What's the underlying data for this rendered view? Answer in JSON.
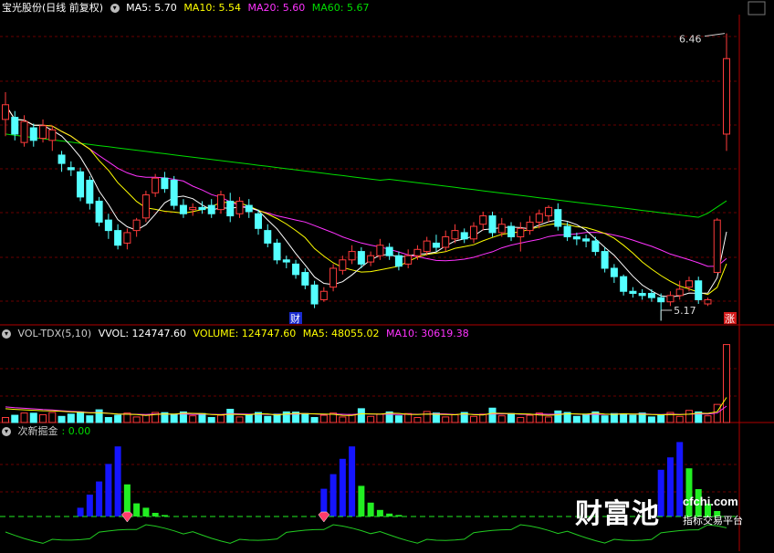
{
  "colors": {
    "up": "#ff3b3b",
    "down": "#54ffff",
    "ma5": "#ffffff",
    "ma10": "#ffff00",
    "ma20": "#ff33ff",
    "ma60": "#00dd00",
    "divider": "#b00000",
    "grid": "#6a0000",
    "bar_blue": "#1515ff",
    "bar_green": "#22ee22"
  },
  "price_panel": {
    "title": "宝光股份(日线 前复权)",
    "ma5_label": "MA5: 5.70",
    "ma10_label": "MA10: 5.54",
    "ma20_label": "MA20: 5.60",
    "ma60_label": "MA60: 5.67",
    "high_marker": "6.46",
    "low_marker": "5.17",
    "finance_badge": "财",
    "limit_up_badge": "涨"
  },
  "volume_panel": {
    "title": "VOL-TDX(5,10)",
    "vvol_label": "VVOL: 124747.60",
    "volume_label": "VOLUME: 124747.60",
    "ma5_label": "MA5: 48055.02",
    "ma10_label": "MA10: 30619.38"
  },
  "indicator_panel": {
    "title": "次新掘金",
    "value_label": ": 0.00"
  },
  "watermark": {
    "brand": "财富池",
    "url": "cfchi.com",
    "slogan": "指标交易平台"
  },
  "chart_data": [
    {
      "type": "candlestick",
      "title": "宝光股份(日线 前复权)",
      "series": [
        {
          "name": "MA5",
          "value": 5.7
        },
        {
          "name": "MA10",
          "value": 5.54
        },
        {
          "name": "MA20",
          "value": 5.6
        },
        {
          "name": "MA60",
          "value": 5.67
        }
      ],
      "high_label": 6.46,
      "low_label": 5.17,
      "ylim": [
        5.07,
        6.55
      ],
      "candles": [
        [
          6.05,
          6.12,
          6.18,
          5.97
        ],
        [
          6.06,
          5.98,
          6.09,
          5.95
        ],
        [
          5.94,
          6.04,
          6.07,
          5.92
        ],
        [
          6.01,
          5.95,
          6.03,
          5.92
        ],
        [
          5.96,
          6.02,
          6.05,
          5.94
        ],
        [
          5.95,
          6.0,
          6.02,
          5.9
        ],
        [
          5.88,
          5.84,
          5.9,
          5.8
        ],
        [
          5.82,
          5.81,
          5.85,
          5.78
        ],
        [
          5.8,
          5.68,
          5.82,
          5.66
        ],
        [
          5.76,
          5.65,
          5.78,
          5.62
        ],
        [
          5.66,
          5.56,
          5.68,
          5.54
        ],
        [
          5.57,
          5.52,
          5.6,
          5.48
        ],
        [
          5.52,
          5.45,
          5.55,
          5.43
        ],
        [
          5.46,
          5.51,
          5.53,
          5.43
        ],
        [
          5.52,
          5.57,
          5.58,
          5.49
        ],
        [
          5.58,
          5.69,
          5.71,
          5.56
        ],
        [
          5.7,
          5.77,
          5.79,
          5.68
        ],
        [
          5.77,
          5.72,
          5.8,
          5.7
        ],
        [
          5.76,
          5.64,
          5.78,
          5.62
        ],
        [
          5.64,
          5.6,
          5.67,
          5.58
        ],
        [
          5.62,
          5.63,
          5.65,
          5.59
        ],
        [
          5.63,
          5.62,
          5.66,
          5.6
        ],
        [
          5.64,
          5.6,
          5.67,
          5.58
        ],
        [
          5.62,
          5.69,
          5.71,
          5.6
        ],
        [
          5.66,
          5.59,
          5.7,
          5.56
        ],
        [
          5.6,
          5.66,
          5.68,
          5.58
        ],
        [
          5.64,
          5.61,
          5.67,
          5.58
        ],
        [
          5.6,
          5.53,
          5.62,
          5.5
        ],
        [
          5.52,
          5.46,
          5.55,
          5.44
        ],
        [
          5.46,
          5.38,
          5.48,
          5.36
        ],
        [
          5.38,
          5.37,
          5.4,
          5.34
        ],
        [
          5.36,
          5.31,
          5.38,
          5.29
        ],
        [
          5.32,
          5.26,
          5.34,
          5.24
        ],
        [
          5.26,
          5.17,
          5.28,
          5.15
        ],
        [
          5.19,
          5.23,
          5.25,
          5.18
        ],
        [
          5.25,
          5.34,
          5.36,
          5.23
        ],
        [
          5.33,
          5.38,
          5.4,
          5.31
        ],
        [
          5.38,
          5.42,
          5.45,
          5.36
        ],
        [
          5.42,
          5.36,
          5.44,
          5.34
        ],
        [
          5.37,
          5.4,
          5.42,
          5.35
        ],
        [
          5.4,
          5.45,
          5.48,
          5.38
        ],
        [
          5.44,
          5.4,
          5.46,
          5.38
        ],
        [
          5.4,
          5.35,
          5.42,
          5.33
        ],
        [
          5.36,
          5.4,
          5.43,
          5.34
        ],
        [
          5.4,
          5.43,
          5.45,
          5.38
        ],
        [
          5.42,
          5.47,
          5.49,
          5.4
        ],
        [
          5.46,
          5.44,
          5.5,
          5.42
        ],
        [
          5.44,
          5.49,
          5.52,
          5.42
        ],
        [
          5.48,
          5.52,
          5.55,
          5.46
        ],
        [
          5.51,
          5.48,
          5.53,
          5.46
        ],
        [
          5.48,
          5.54,
          5.56,
          5.46
        ],
        [
          5.55,
          5.59,
          5.61,
          5.52
        ],
        [
          5.59,
          5.51,
          5.61,
          5.49
        ],
        [
          5.51,
          5.55,
          5.58,
          5.49
        ],
        [
          5.54,
          5.49,
          5.56,
          5.47
        ],
        [
          5.49,
          5.53,
          5.56,
          5.42
        ],
        [
          5.52,
          5.56,
          5.59,
          5.5
        ],
        [
          5.56,
          5.6,
          5.62,
          5.53
        ],
        [
          5.59,
          5.63,
          5.64,
          5.56
        ],
        [
          5.62,
          5.54,
          5.65,
          5.52
        ],
        [
          5.54,
          5.49,
          5.56,
          5.47
        ],
        [
          5.49,
          5.48,
          5.51,
          5.45
        ],
        [
          5.48,
          5.47,
          5.5,
          5.44
        ],
        [
          5.47,
          5.42,
          5.49,
          5.4
        ],
        [
          5.42,
          5.34,
          5.44,
          5.32
        ],
        [
          5.34,
          5.3,
          5.36,
          5.27
        ],
        [
          5.3,
          5.23,
          5.31,
          5.21
        ],
        [
          5.23,
          5.22,
          5.25,
          5.2
        ],
        [
          5.22,
          5.21,
          5.24,
          5.19
        ],
        [
          5.22,
          5.2,
          5.24,
          5.18
        ],
        [
          5.2,
          5.18,
          5.22,
          5.09
        ],
        [
          5.18,
          5.21,
          5.23,
          5.16
        ],
        [
          5.21,
          5.24,
          5.28,
          5.19
        ],
        [
          5.25,
          5.28,
          5.3,
          5.23
        ],
        [
          5.28,
          5.19,
          5.3,
          5.17
        ],
        [
          5.17,
          5.19,
          5.2,
          5.16
        ],
        [
          5.32,
          5.57,
          5.58,
          5.32
        ],
        [
          5.98,
          6.34,
          6.46,
          5.9
        ]
      ]
    },
    {
      "type": "bar",
      "title": "VOL-TDX(5,10)",
      "series": [
        {
          "name": "VOLUME",
          "value": 124747.6
        },
        {
          "name": "MA5",
          "value": 48055.02
        },
        {
          "name": "MA10",
          "value": 30619.38
        }
      ],
      "values": [
        25000,
        23000,
        21500,
        20000,
        18500,
        17500,
        16500,
        15800,
        15200,
        14800,
        14200,
        13800,
        13500,
        13200,
        13000,
        12800,
        12700,
        12500,
        12300,
        12200,
        12000,
        11900,
        11800,
        11700,
        11600,
        11500,
        11400,
        11300,
        11200,
        11100,
        11000,
        10900,
        10800,
        10700,
        10600,
        10500,
        10400,
        10300,
        10200,
        10100,
        10000,
        9900,
        9800,
        9700,
        9600,
        9500,
        9400,
        9300,
        9200,
        9100,
        9000,
        8900,
        8800,
        8700,
        8600,
        8500,
        8400,
        8300,
        8200,
        8100,
        8000,
        7900,
        7800,
        7700,
        7600,
        7500,
        7400,
        7300,
        7200,
        7100,
        7000,
        6900,
        6800,
        6700,
        6600,
        6500,
        29000,
        124747.6
      ]
    },
    {
      "type": "bar",
      "title": "次新掘金",
      "value": 0.0,
      "series": [
        {
          "name": "blue",
          "values": [
            0,
            0,
            0,
            0,
            0,
            0,
            0,
            0,
            12,
            30,
            48,
            72,
            96,
            0,
            0,
            0,
            0,
            0,
            0,
            0,
            0,
            0,
            0,
            0,
            0,
            0,
            0,
            0,
            0,
            0,
            0,
            0,
            0,
            0,
            38,
            58,
            79,
            96,
            0,
            0,
            0,
            0,
            0,
            0,
            0,
            0,
            0,
            0,
            0,
            0,
            0,
            0,
            0,
            0,
            0,
            0,
            0,
            0,
            0,
            0,
            0,
            0,
            0,
            0,
            0,
            0,
            0,
            0,
            0,
            0,
            0,
            0,
            0,
            0,
            0,
            0,
            0,
            0
          ]
        },
        {
          "name": "green",
          "values": [
            0,
            0,
            0,
            0,
            0,
            0,
            0,
            0,
            0,
            0,
            0,
            0,
            0,
            44,
            18,
            12,
            5,
            2,
            0,
            0,
            0,
            0,
            0,
            0,
            0,
            0,
            0,
            0,
            0,
            0,
            0,
            0,
            0,
            0,
            0,
            0,
            0,
            0,
            42,
            19,
            9,
            4,
            2,
            0,
            0,
            0,
            0,
            0,
            0,
            0,
            0,
            0,
            0,
            0,
            0,
            0,
            0,
            0,
            0,
            0,
            0,
            0,
            0,
            0,
            0,
            0,
            0,
            0,
            0,
            0,
            0,
            0,
            0,
            0,
            0,
            0,
            0,
            0
          ]
        },
        {
          "name": "blue_right",
          "values": [
            0,
            0,
            0,
            0,
            0,
            0,
            0,
            0,
            0,
            0,
            0,
            0,
            0,
            0,
            0,
            0,
            0,
            0,
            0,
            0,
            0,
            0,
            0,
            0,
            0,
            0,
            0,
            0,
            0,
            0,
            0,
            0,
            0,
            0,
            0,
            0,
            0,
            0,
            0,
            0,
            0,
            0,
            0,
            0,
            0,
            0,
            0,
            0,
            0,
            0,
            0,
            0,
            0,
            0,
            0,
            0,
            0,
            0,
            0,
            0,
            0,
            0,
            0,
            0,
            0,
            0,
            0,
            0,
            0,
            0,
            64,
            81,
            102,
            66,
            0,
            0,
            0,
            0
          ]
        }
      ]
    }
  ]
}
